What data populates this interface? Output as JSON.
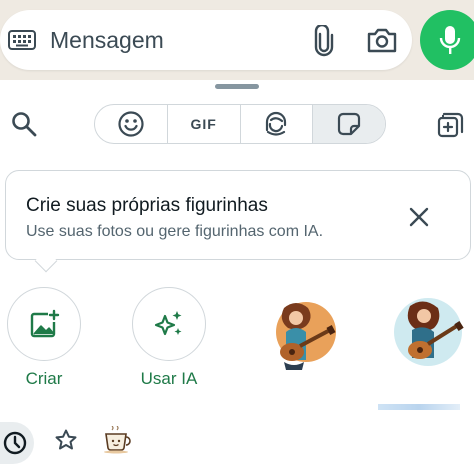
{
  "composer": {
    "placeholder": "Mensagem",
    "keyboard_icon": "keyboard-icon",
    "attach_icon": "paperclip-icon",
    "camera_icon": "camera-icon",
    "mic_icon": "microphone-icon"
  },
  "tabs": [
    {
      "name": "emoji",
      "icon": "smiley-icon",
      "label": ""
    },
    {
      "name": "gif",
      "icon": "",
      "label": "GIF"
    },
    {
      "name": "avatar",
      "icon": "avatar-sticker-icon",
      "label": ""
    },
    {
      "name": "stickers",
      "icon": "sticker-icon",
      "label": "",
      "active": true
    }
  ],
  "tooltip": {
    "title": "Crie suas próprias figurinhas",
    "subtitle": "Use suas fotos ou gere figurinhas com IA."
  },
  "actions": [
    {
      "label": "Criar",
      "icon": "image-plus-icon"
    },
    {
      "label": "Usar IA",
      "icon": "sparkles-icon"
    }
  ],
  "colors": {
    "accent": "#21c063",
    "label_green": "#1f7a48",
    "border": "#d1d7db",
    "icon_gray": "#3b4a54"
  }
}
